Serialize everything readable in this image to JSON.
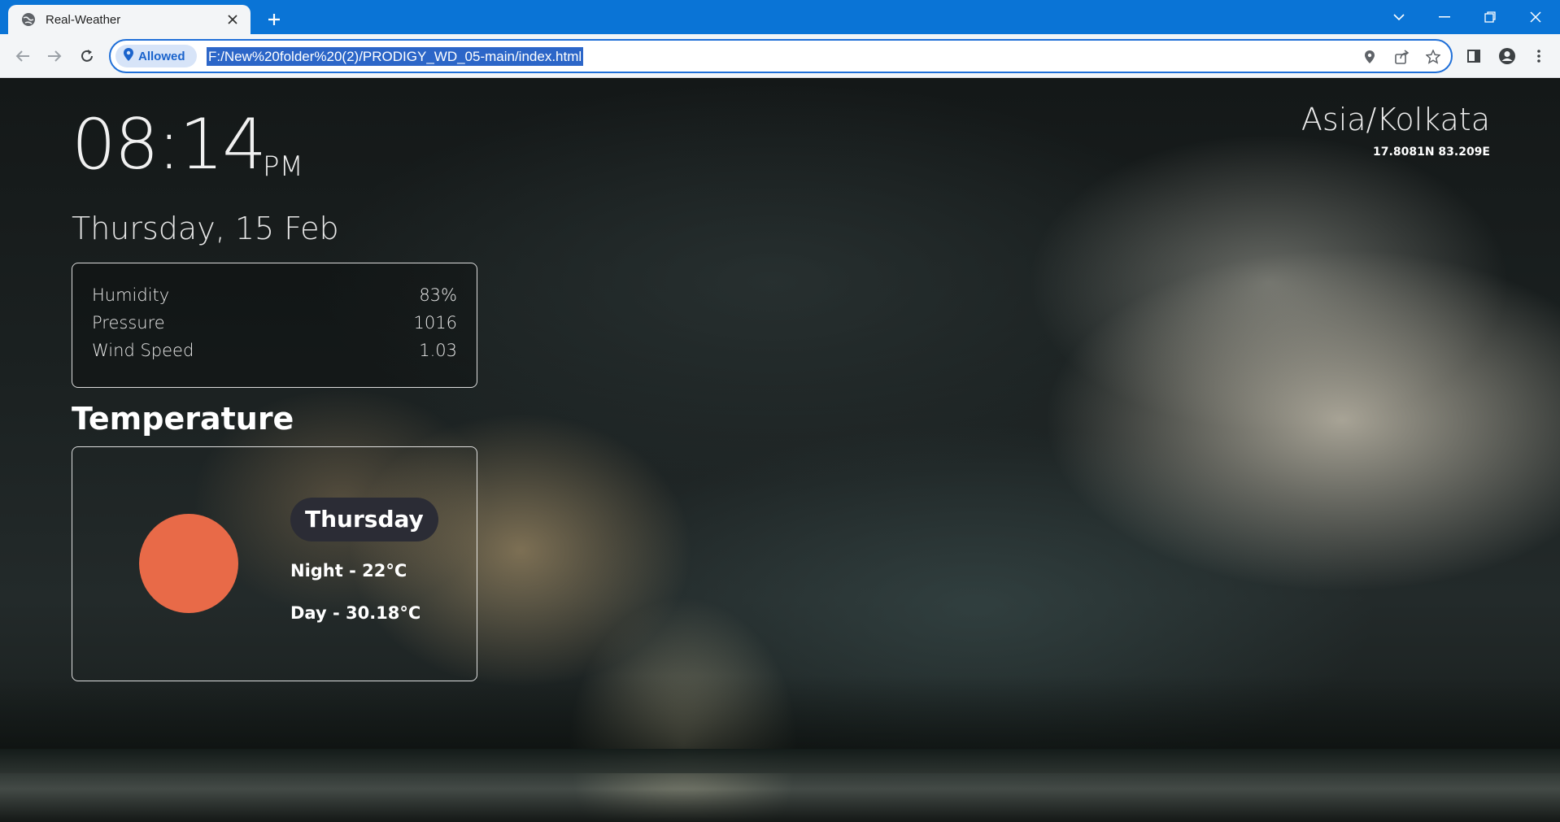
{
  "browser": {
    "tab_title": "Real-Weather",
    "site_permission_label": "Allowed",
    "url": "F:/New%20folder%20(2)/PRODIGY_WD_05-main/index.html"
  },
  "weather": {
    "time": "08:14",
    "ampm": "PM",
    "date": "Thursday, 15 Feb",
    "timezone": "Asia/Kolkata",
    "coordinates": "17.8081N 83.209E",
    "stats": [
      {
        "label": "Humidity",
        "value": "83%"
      },
      {
        "label": "Pressure",
        "value": "1016"
      },
      {
        "label": "Wind Speed",
        "value": "1.03"
      }
    ],
    "temperature_heading": "Temperature",
    "forecast": {
      "day": "Thursday",
      "night": "Night - 22°C",
      "daytime": "Day - 30.18°C"
    }
  },
  "colors": {
    "titlebar": "#0a74d6",
    "sun": "#e86a48",
    "pill": "#2b2c35"
  }
}
